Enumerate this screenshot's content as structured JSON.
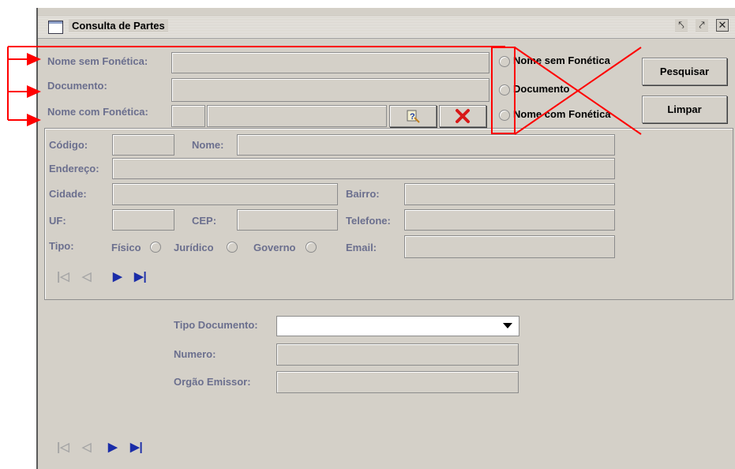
{
  "window": {
    "title": "Consulta de Partes"
  },
  "title_buttons": {
    "minimize": "↘↙",
    "maximize": "↗",
    "close": "☒"
  },
  "search": {
    "labels": {
      "nome_sem_fonetica": "Nome sem Fonética:",
      "documento": "Documento:",
      "nome_com_fonetica": "Nome com Fonética:"
    },
    "values": {
      "nome_sem_fonetica": "",
      "documento": "",
      "nome_com_fonetica_a": "",
      "nome_com_fonetica_b": ""
    }
  },
  "radio_options": [
    "Nome sem Fonética",
    "Documento",
    "Nome com Fonética"
  ],
  "buttons": {
    "pesquisar": "Pesquisar",
    "limpar": "Limpar"
  },
  "details": {
    "labels": {
      "codigo": "Código:",
      "nome": "Nome:",
      "endereco": "Endereço:",
      "cidade": "Cidade:",
      "bairro": "Bairro:",
      "uf": "UF:",
      "cep": "CEP:",
      "telefone": "Telefone:",
      "tipo": "Tipo:",
      "email": "Email:"
    },
    "tipo_options": [
      "Físico",
      "Jurídico",
      "Governo"
    ],
    "values": {
      "codigo": "",
      "nome": "",
      "endereco": "",
      "cidade": "",
      "bairro": "",
      "uf": "",
      "cep": "",
      "telefone": "",
      "email": ""
    }
  },
  "documento_section": {
    "labels": {
      "tipo_documento": "Tipo Documento:",
      "numero": "Numero:",
      "orgao_emissor": "Orgão Emissor:"
    },
    "values": {
      "tipo_documento": "",
      "numero": "",
      "orgao_emissor": ""
    }
  },
  "navigator": {
    "first": "|◁",
    "prev": "◁",
    "next": "▶",
    "last": "▶|"
  },
  "annotation": {
    "color": "#ff0000"
  }
}
